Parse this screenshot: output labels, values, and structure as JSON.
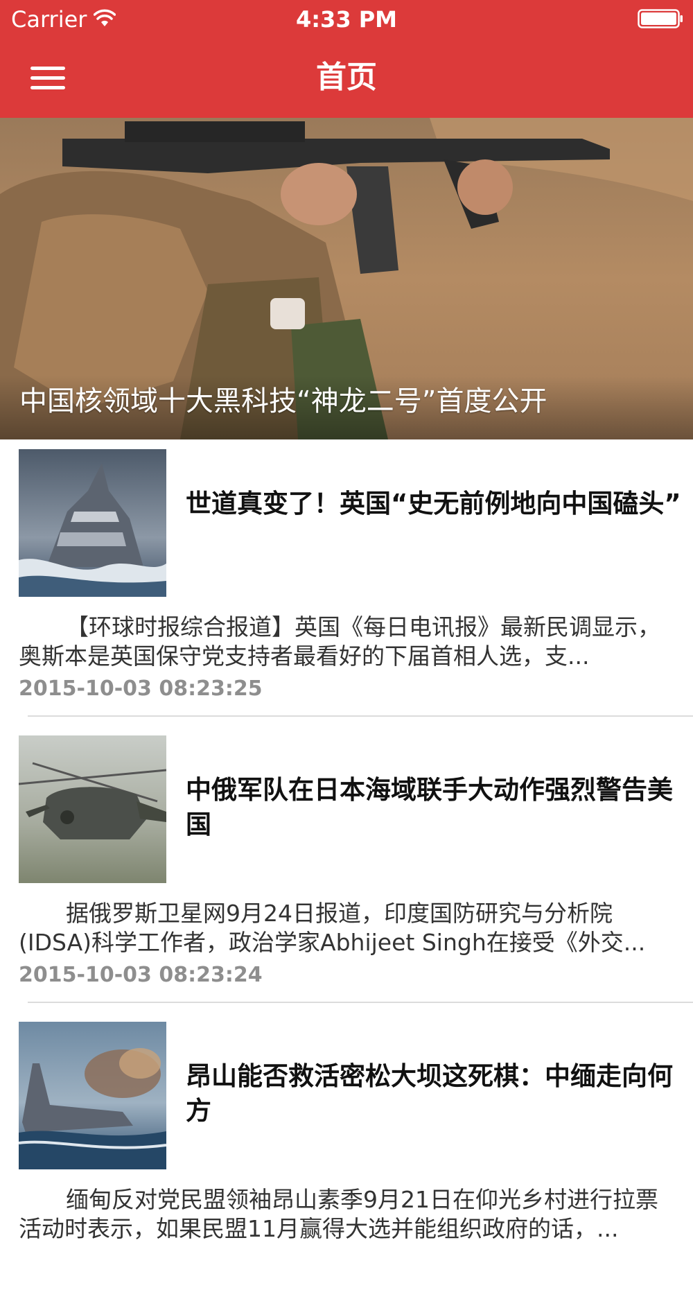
{
  "status_bar": {
    "carrier": "Carrier",
    "time": "4:33 PM",
    "wifi_icon": "wifi-icon",
    "battery_icon": "battery-icon"
  },
  "nav": {
    "title": "首页",
    "menu_icon": "hamburger-menu-icon"
  },
  "colors": {
    "accent": "#dc3a3a",
    "date_text": "#8e8e8e",
    "divider": "#dcdcdc"
  },
  "hero": {
    "title": "中国核领域十大黑科技“神龙二号”首度公开",
    "image": "soldier-rifle-photo"
  },
  "articles": [
    {
      "title": "世道真变了！英国“史无前例地向中国磕头”",
      "summary": "【环球时报综合报道】英国《每日电讯报》最新民调显示，奥斯本是英国保守党支持者最看好的下届首相人选，支...",
      "date": "2015-10-03 08:23:25",
      "image": "battleship-painting"
    },
    {
      "title": "中俄军队在日本海域联手大动作强烈警告美国",
      "summary": "据俄罗斯卫星网9月24日报道，印度国防研究与分析院(IDSA)科学工作者，政治学家Abhijeet Singh在接受《外交...",
      "date": "2015-10-03 08:23:24",
      "image": "helicopter-painting"
    },
    {
      "title": "昂山能否救活密松大坝这死棋：中缅走向何方",
      "summary": "缅甸反对党民盟领袖昂山素季9月21日在仰光乡村进行拉票活动时表示，如果民盟11月赢得大选并能组织政府的话，...",
      "date": "",
      "image": "warship-firing-painting"
    }
  ]
}
